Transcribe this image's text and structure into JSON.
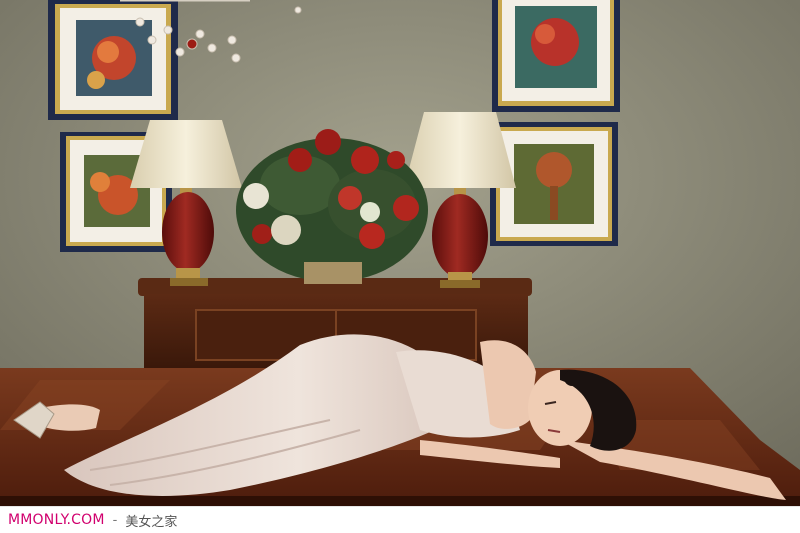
{
  "image": {
    "subject": "photo-scene",
    "colors": {
      "wall": "#8c8a78",
      "table_wood": "#6b2d18",
      "dress": "#e7d8cf",
      "lamp_base": "#7e1512",
      "lamp_shade": "#efe6c8",
      "frame_navy": "#1f2a4a"
    }
  },
  "watermark": {
    "site": "MMONLY.COM",
    "separator": "-",
    "tagline": "美女之家"
  }
}
